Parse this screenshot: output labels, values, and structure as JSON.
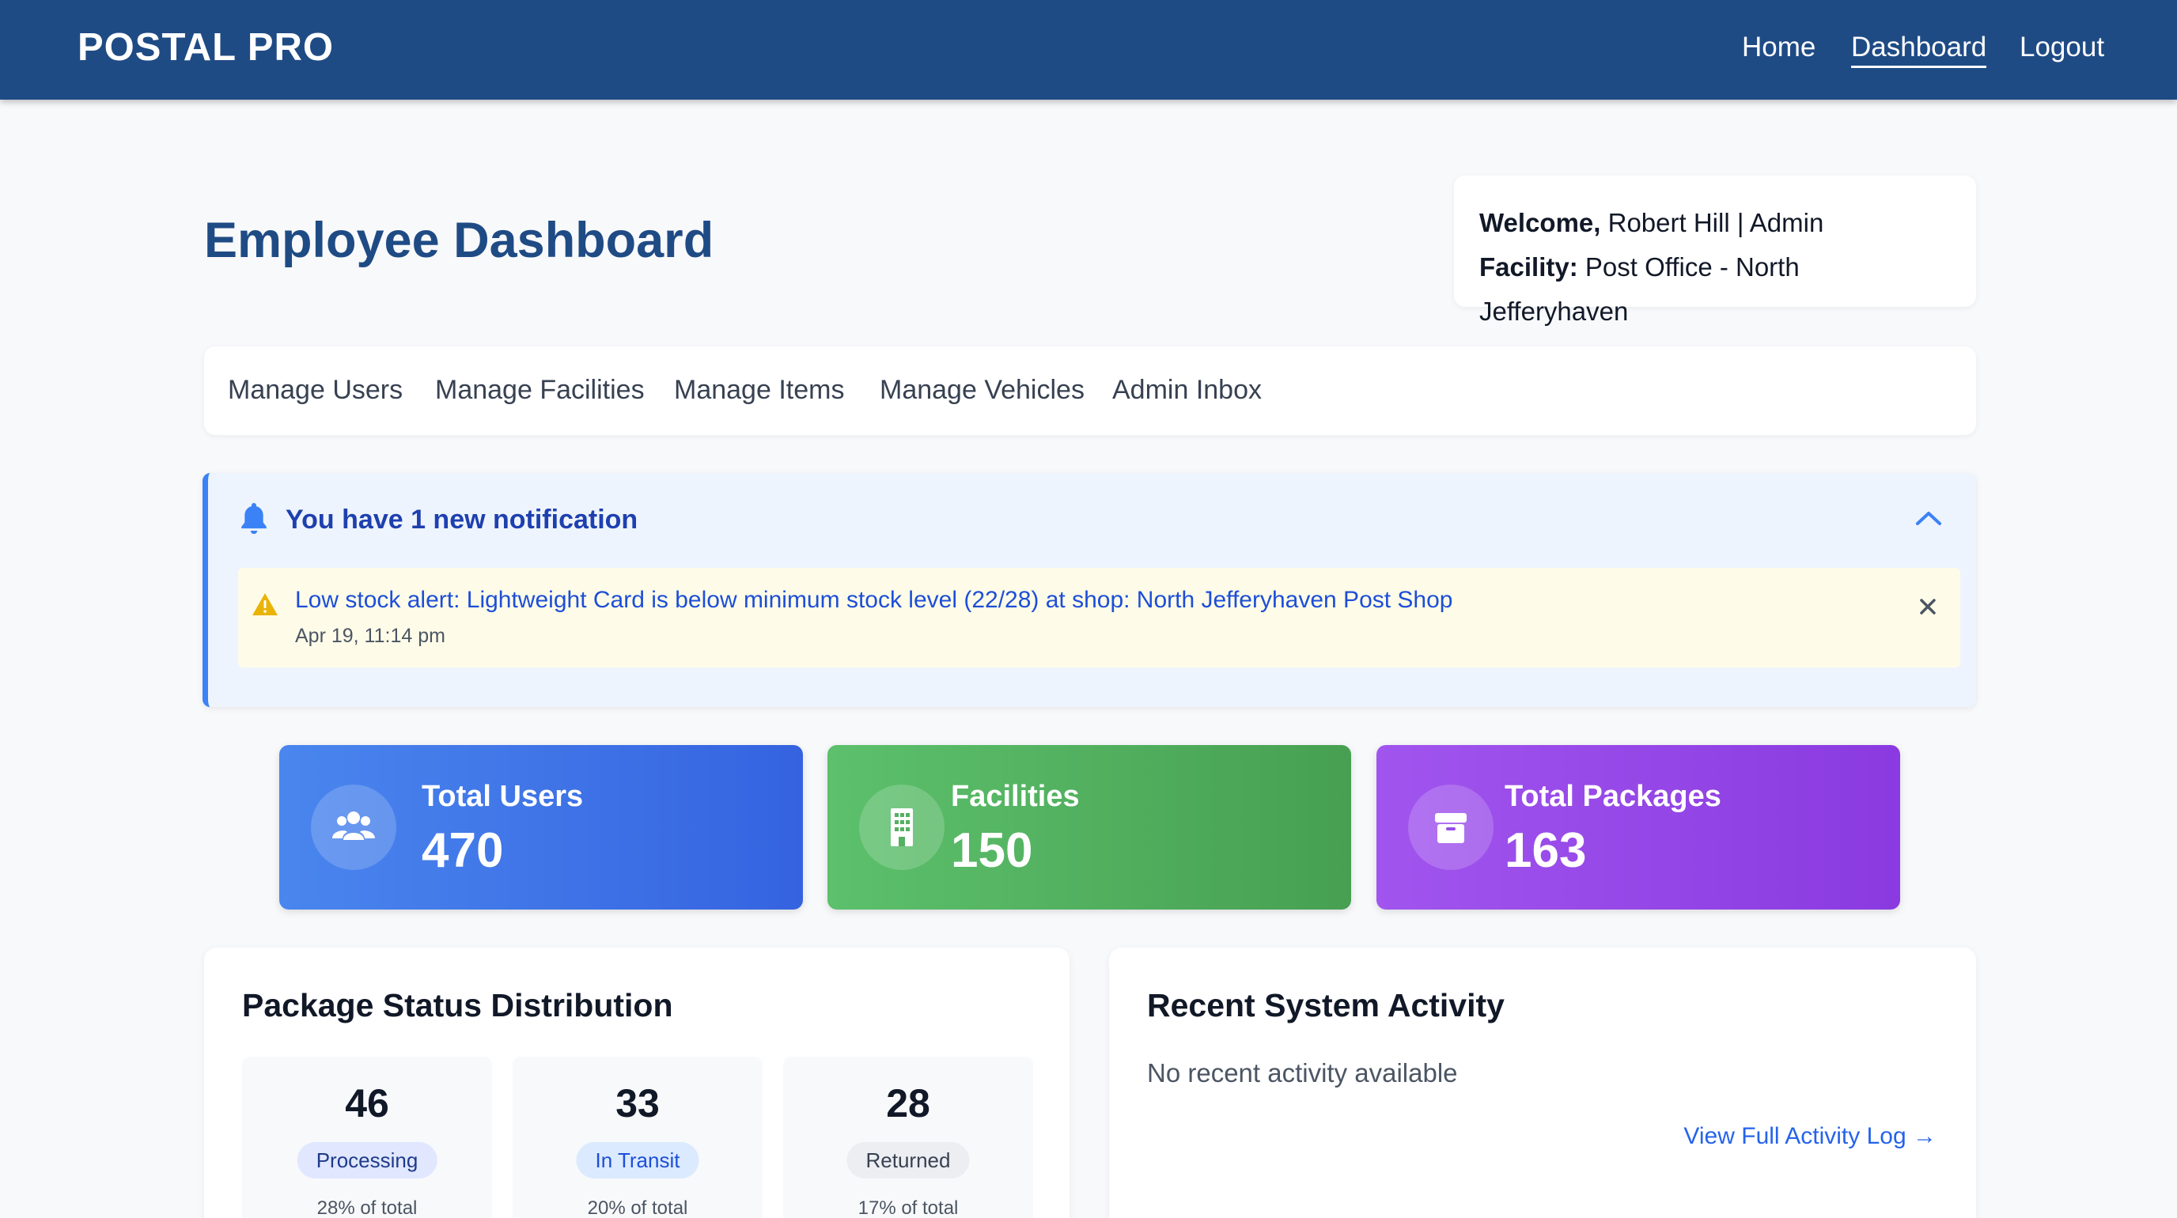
{
  "header": {
    "brand": "POSTAL PRO",
    "nav": [
      {
        "label": "Home"
      },
      {
        "label": "Dashboard",
        "active": true
      },
      {
        "label": "Logout"
      }
    ]
  },
  "page": {
    "title": "Employee Dashboard"
  },
  "welcome": {
    "welcome_label": "Welcome,",
    "user": "Robert Hill | Admin",
    "facility_label": "Facility:",
    "facility": "Post Office - North Jefferyhaven"
  },
  "admin_nav": {
    "items": [
      {
        "label": "Manage Users"
      },
      {
        "label": "Manage Facilities"
      },
      {
        "label": "Manage Items"
      },
      {
        "label": "Manage Vehicles"
      },
      {
        "label": "Admin Inbox"
      }
    ]
  },
  "notifications": {
    "title": "You have 1 new notification",
    "items": [
      {
        "message": "Low stock alert: Lightweight Card is below minimum stock level (22/28) at shop: North Jefferyhaven Post Shop",
        "time": "Apr 19, 11:14 pm"
      }
    ]
  },
  "stats": [
    {
      "label": "Total Users",
      "value": "470",
      "icon": "users-icon"
    },
    {
      "label": "Facilities",
      "value": "150",
      "icon": "building-icon"
    },
    {
      "label": "Total Packages",
      "value": "163",
      "icon": "package-icon"
    }
  ],
  "package_status": {
    "title": "Package Status Distribution",
    "items": [
      {
        "count": "46",
        "label": "Processing",
        "pct": "28% of total",
        "badge_bg": "#e0e7ff",
        "badge_fg": "#1e3a8a"
      },
      {
        "count": "33",
        "label": "In Transit",
        "pct": "20% of total",
        "badge_bg": "#dbeafe",
        "badge_fg": "#1d4ed8"
      },
      {
        "count": "28",
        "label": "Returned",
        "pct": "17% of total",
        "badge_bg": "#eceef2",
        "badge_fg": "#374151"
      }
    ]
  },
  "activity": {
    "title": "Recent System Activity",
    "empty_text": "No recent activity available",
    "link_label": "View Full Activity Log →"
  },
  "colors": {
    "header_bg": "#1f4b85",
    "accent": "#3b82f6"
  }
}
